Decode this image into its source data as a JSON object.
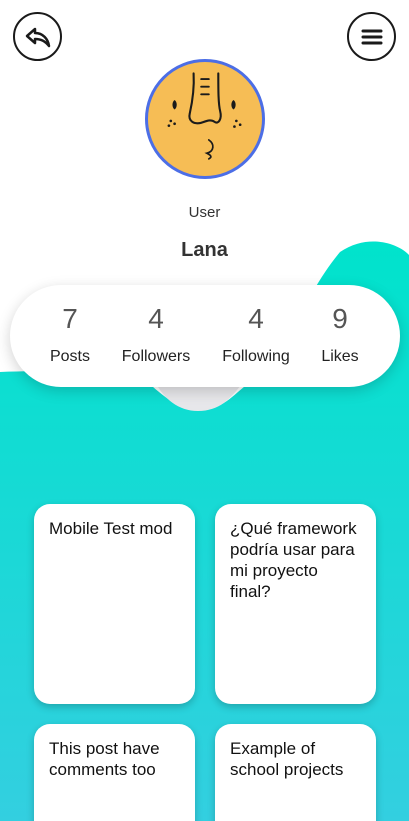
{
  "colors": {
    "teal_top": "#00e3cc",
    "teal_bottom": "#33cfe0",
    "avatar_fill": "#f6bd55",
    "avatar_border": "#4c6ee6"
  },
  "header": {
    "back_icon": "back-arrow-icon",
    "menu_icon": "hamburger-menu-icon"
  },
  "profile": {
    "role": "User",
    "name": "Lana"
  },
  "stats": [
    {
      "value": "7",
      "label": "Posts"
    },
    {
      "value": "4",
      "label": "Followers"
    },
    {
      "value": "4",
      "label": "Following"
    },
    {
      "value": "9",
      "label": "Likes"
    }
  ],
  "posts": [
    {
      "title": "Mobile Test mod"
    },
    {
      "title": "¿Qué framework podría usar para mi proyecto final?"
    },
    {
      "title": "This post have comments too"
    },
    {
      "title": "Example of school projects"
    }
  ]
}
